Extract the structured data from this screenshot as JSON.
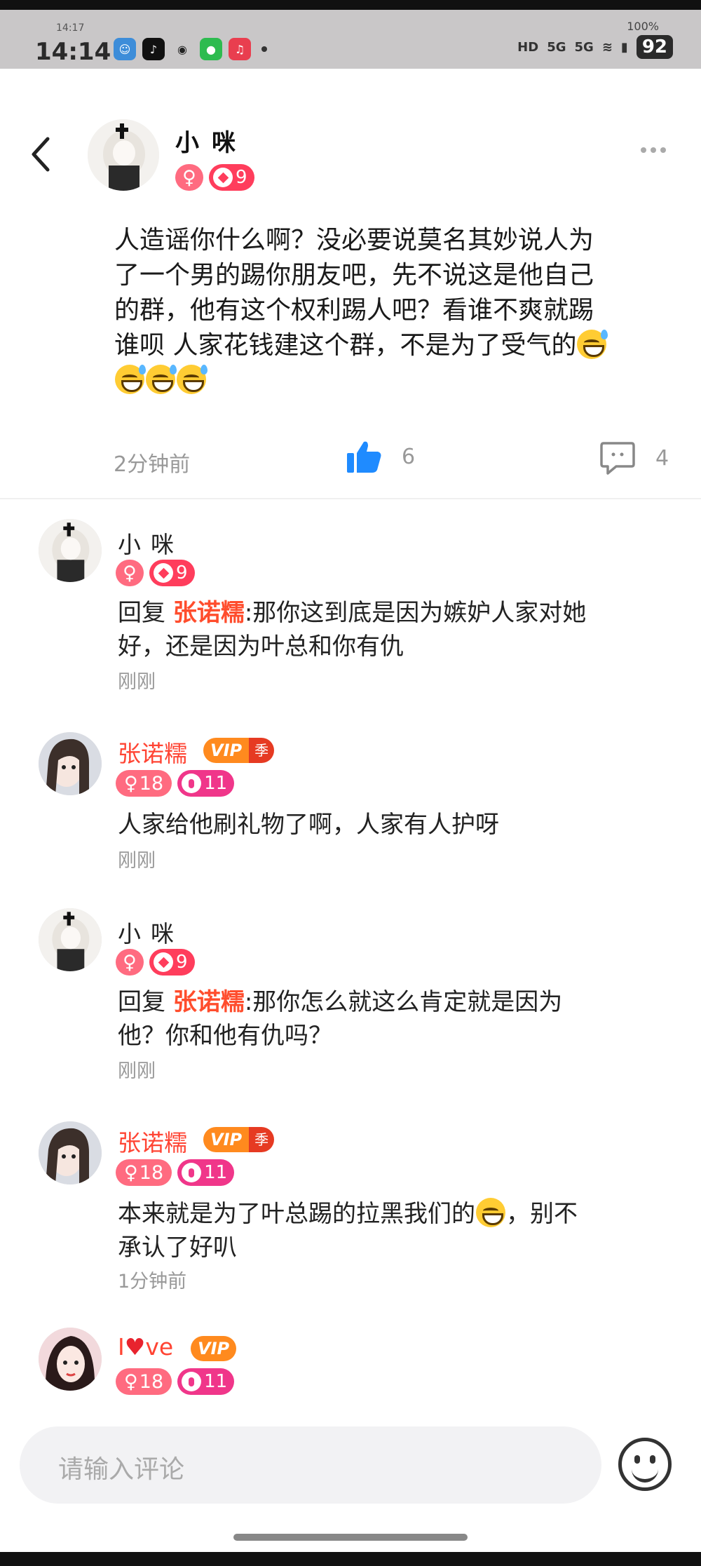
{
  "status_bar": {
    "time": "14:14",
    "sub_time": "14:17",
    "battery": "92",
    "battery_top": "100%",
    "network_1": "5G",
    "network_2": "5G"
  },
  "post": {
    "author": "小咪",
    "level": "9",
    "text_lines": [
      "人造谣你什么啊？没必要说莫名其妙说人为",
      "了一个男的踢你朋友吧，先不说这是他自己",
      "的群，他有这个权利踢人吧？看谁不爽就踢",
      "谁呗 人家花钱建这个群，不是为了受气的"
    ],
    "time": "2分钟前",
    "like_count": "6",
    "comment_count": "4"
  },
  "comments": [
    {
      "name": "小咪",
      "level": "9",
      "reply_prefix": "回复 ",
      "reply_to": "张诺糯",
      "text_line1": ":那你这到底是因为嫉妒人家对她",
      "text_line2": "好，还是因为叶总和你有仇",
      "time": "刚刚"
    },
    {
      "name": "张诺糯",
      "vip_label": "VIP",
      "vip_season": "季",
      "age": "18",
      "level": "11",
      "text_line1": "人家给他刷礼物了啊，人家有人护呀",
      "time": "刚刚"
    },
    {
      "name": "小咪",
      "level": "9",
      "reply_prefix": "回复 ",
      "reply_to": "张诺糯",
      "text_line1": ":那你怎么就这么肯定就是因为",
      "text_line2": "他？你和他有仇吗？",
      "time": "刚刚"
    },
    {
      "name": "张诺糯",
      "vip_label": "VIP",
      "vip_season": "季",
      "age": "18",
      "level": "11",
      "text_line1": "本来就是为了叶总踢的拉黑我们的",
      "text_line1_tail": "，别不",
      "text_line2": "承认了好叭",
      "time": "1分钟前"
    },
    {
      "name_pre": "I",
      "name_post": "ve",
      "vip_label": "VIP",
      "age": "18",
      "level": "11"
    }
  ],
  "input": {
    "placeholder": "请输入评论"
  },
  "colors": {
    "accent_red": "#ff4d2d",
    "like_blue": "#1f8bff",
    "sex_badge": "#ff6b80",
    "level_badge": "#ff3d5c"
  },
  "icons": [
    "back-arrow-icon",
    "more-dots-icon",
    "thumbs-up-icon",
    "comment-bubble-icon",
    "female-icon",
    "level-diamond-icon",
    "heart-icon",
    "smiley-face-icon"
  ]
}
